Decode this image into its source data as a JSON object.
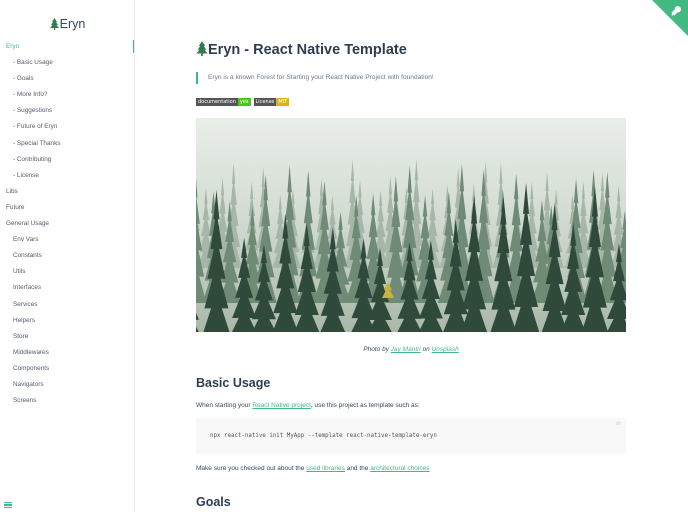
{
  "sidebar": {
    "brand": "Eryn",
    "items": [
      {
        "label": "Eryn",
        "level": 0,
        "active": true
      },
      {
        "label": "- Basic Usage",
        "level": 1
      },
      {
        "label": "- Goals",
        "level": 1
      },
      {
        "label": "- More Info?",
        "level": 1
      },
      {
        "label": "- Suggestions",
        "level": 1
      },
      {
        "label": "- Future of Eryn",
        "level": 1
      },
      {
        "label": "- Special Thanks",
        "level": 1
      },
      {
        "label": "- Contributing",
        "level": 1
      },
      {
        "label": "- License",
        "level": 1
      },
      {
        "label": "Libs",
        "level": 0
      },
      {
        "label": "Future",
        "level": 0
      },
      {
        "label": "General Usage",
        "level": 0
      },
      {
        "label": "Env Vars",
        "level": 1
      },
      {
        "label": "Constants",
        "level": 1
      },
      {
        "label": "Utils",
        "level": 1
      },
      {
        "label": "Interfaces",
        "level": 1
      },
      {
        "label": "Services",
        "level": 1
      },
      {
        "label": "Helpers",
        "level": 1
      },
      {
        "label": "Store",
        "level": 1
      },
      {
        "label": "Middlewares",
        "level": 1
      },
      {
        "label": "Components",
        "level": 1
      },
      {
        "label": "Navigators",
        "level": 1
      },
      {
        "label": "Screens",
        "level": 1
      }
    ]
  },
  "main": {
    "title": "Eryn - React Native Template",
    "tagline": "Eryn is a known Forest for Starting your React Native Project with foundation!",
    "badges": [
      {
        "label": "documentation",
        "value": "yes",
        "color": "#4c1"
      },
      {
        "label": "License",
        "value": "MIT",
        "color": "#dfb317"
      }
    ],
    "caption": {
      "prefix": "Photo by",
      "author": "Jay Mantri",
      "middle": "on",
      "site": "Unsplash"
    },
    "basic_usage": {
      "heading": "Basic Usage",
      "intro_prefix": "When starting your",
      "intro_link": "React Native project",
      "intro_suffix": ", use this project as template such as:",
      "code": "npx react-native init MyApp --template react-native-template-eryn",
      "code_lang": "sh",
      "outro_prefix": "Make sure you checked out about the",
      "outro_link1": "used libraries",
      "outro_middle": "and the",
      "outro_link2": "architectural choices"
    },
    "goals": {
      "heading": "Goals"
    }
  },
  "colors": {
    "accent": "#42b983",
    "text": "#34495e",
    "heading": "#2c3e50"
  }
}
